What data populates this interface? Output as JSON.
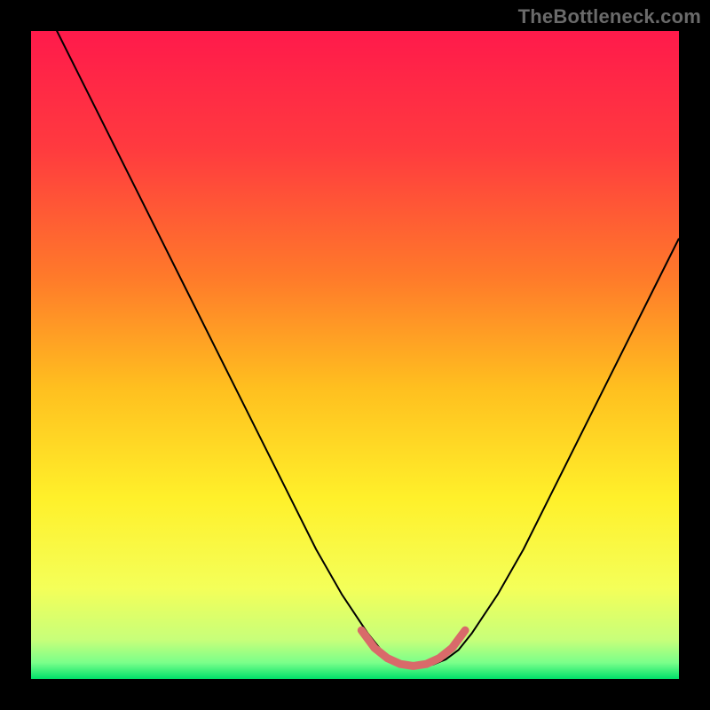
{
  "watermark": "TheBottleneck.com",
  "chart_data": {
    "type": "line",
    "title": "",
    "xlabel": "",
    "ylabel": "",
    "xlim": [
      0,
      100
    ],
    "ylim": [
      0,
      100
    ],
    "grid": false,
    "legend": false,
    "background_gradient_stops": [
      {
        "offset": 0.0,
        "color": "#ff1a4b"
      },
      {
        "offset": 0.18,
        "color": "#ff3a3f"
      },
      {
        "offset": 0.38,
        "color": "#ff7a2a"
      },
      {
        "offset": 0.55,
        "color": "#ffbf1f"
      },
      {
        "offset": 0.72,
        "color": "#fff02a"
      },
      {
        "offset": 0.86,
        "color": "#f4ff59"
      },
      {
        "offset": 0.94,
        "color": "#c7ff7a"
      },
      {
        "offset": 0.975,
        "color": "#7aff8a"
      },
      {
        "offset": 1.0,
        "color": "#00e06a"
      }
    ],
    "series": [
      {
        "name": "curve",
        "stroke": "#000000",
        "stroke_width": 2,
        "x": [
          0,
          4,
          8,
          12,
          16,
          20,
          24,
          28,
          32,
          36,
          40,
          44,
          48,
          52,
          54,
          56,
          58,
          60,
          62,
          64,
          66,
          68,
          72,
          76,
          80,
          84,
          88,
          92,
          96,
          100
        ],
        "y": [
          108,
          100,
          92,
          84,
          76,
          68,
          60,
          52,
          44,
          36,
          28,
          20,
          13,
          7,
          4.5,
          3,
          2.2,
          2,
          2.2,
          3,
          4.5,
          7,
          13,
          20,
          28,
          36,
          44,
          52,
          60,
          68
        ]
      },
      {
        "name": "bottom-highlight",
        "stroke": "#d96a6a",
        "stroke_width": 9,
        "stroke_linecap": "round",
        "x": [
          51,
          53,
          55,
          57,
          59,
          61,
          63,
          65,
          67
        ],
        "y": [
          7.5,
          4.8,
          3.2,
          2.3,
          2.0,
          2.3,
          3.2,
          4.8,
          7.5
        ]
      }
    ]
  }
}
